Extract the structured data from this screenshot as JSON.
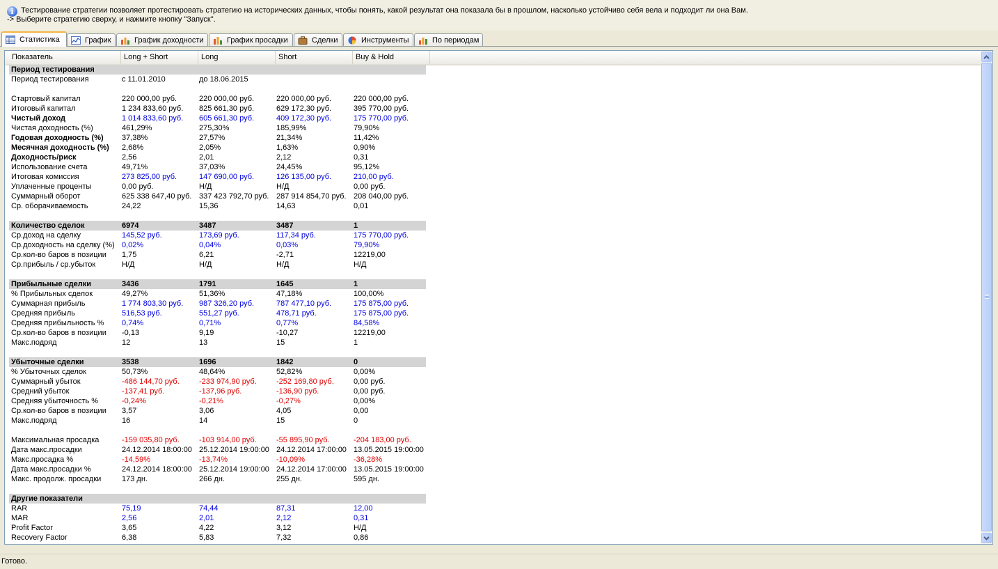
{
  "info": {
    "line1": "Тестирование стратегии позволяет протестировать стратегию на исторических данных, чтобы понять, какой результат она показала бы в прошлом, насколько устойчиво себя вела и подходит ли она Вам.",
    "line2": "-> Выберите стратегию сверху, и нажмите кнопку \"Запуск\"."
  },
  "tabs": [
    {
      "label": "Статистика",
      "icon": "table-icon"
    },
    {
      "label": "График",
      "icon": "chart-icon"
    },
    {
      "label": "График доходности",
      "icon": "bar-chart-icon"
    },
    {
      "label": "График просадки",
      "icon": "bar-chart-icon"
    },
    {
      "label": "Сделки",
      "icon": "briefcase-icon"
    },
    {
      "label": "Инструменты",
      "icon": "pie-chart-icon"
    },
    {
      "label": "По периодам",
      "icon": "bar-chart-icon"
    }
  ],
  "colors": {
    "positive": "#0000e0",
    "negative": "#e00000",
    "section_band": "#d4d4d4",
    "active_tab": "#f8b344"
  },
  "table": {
    "columns": [
      "Показатель",
      "Long + Short",
      "Long",
      "Short",
      "Buy & Hold"
    ],
    "rows": [
      {
        "kind": "section",
        "cells": [
          "Период тестирования",
          "",
          "",
          "",
          ""
        ]
      },
      {
        "kind": "row",
        "cells": [
          "Период тестирования",
          "с 11.01.2010",
          "до 18.06.2015",
          "",
          ""
        ]
      },
      {
        "kind": "blank"
      },
      {
        "kind": "row",
        "cells": [
          "Стартовый капитал",
          "220 000,00 руб.",
          "220 000,00 руб.",
          "220 000,00 руб.",
          "220 000,00 руб."
        ]
      },
      {
        "kind": "row",
        "cells": [
          "Итоговый капитал",
          "1 234 833,60 руб.",
          "825 661,30 руб.",
          "629 172,30 руб.",
          "395 770,00 руб."
        ]
      },
      {
        "kind": "row",
        "bold": true,
        "color": "blue",
        "cells": [
          "Чистый доход",
          "1 014 833,60 руб.",
          "605 661,30 руб.",
          "409 172,30 руб.",
          "175 770,00 руб."
        ]
      },
      {
        "kind": "row",
        "cells": [
          "Чистая доходность (%)",
          "461,29%",
          "275,30%",
          "185,99%",
          "79,90%"
        ]
      },
      {
        "kind": "row",
        "bold": true,
        "cells": [
          "Годовая доходность (%)",
          "37,38%",
          "27,57%",
          "21,34%",
          "11,42%"
        ]
      },
      {
        "kind": "row",
        "bold": true,
        "cells": [
          "Месячная доходность (%)",
          "2,68%",
          "2,05%",
          "1,63%",
          "0,90%"
        ]
      },
      {
        "kind": "row",
        "bold": true,
        "cells": [
          "Доходность/риск",
          "2,56",
          "2,01",
          "2,12",
          "0,31"
        ]
      },
      {
        "kind": "row",
        "cells": [
          "Использование счета",
          "49,71%",
          "37,03%",
          "24,45%",
          "95,12%"
        ]
      },
      {
        "kind": "row",
        "color": "blue",
        "cells": [
          "Итоговая комиссия",
          "273 825,00 руб.",
          "147 690,00 руб.",
          "126 135,00 руб.",
          "210,00 руб."
        ]
      },
      {
        "kind": "row",
        "cells": [
          "Уплаченные проценты",
          "0,00 руб.",
          "Н/Д",
          "Н/Д",
          "0,00 руб."
        ]
      },
      {
        "kind": "row",
        "cells": [
          "Суммарный оборот",
          "625 338 647,40 руб.",
          "337 423 792,70 руб.",
          "287 914 854,70 руб.",
          "208 040,00 руб."
        ]
      },
      {
        "kind": "row",
        "cells": [
          "Ср. оборачиваемость",
          "24,22",
          "15,36",
          "14,63",
          "0,01"
        ]
      },
      {
        "kind": "blank"
      },
      {
        "kind": "section",
        "cells": [
          "Количество сделок",
          "6974",
          "3487",
          "3487",
          "1"
        ]
      },
      {
        "kind": "row",
        "color": "blue",
        "cells": [
          "Ср.доход на сделку",
          "145,52 руб.",
          "173,69 руб.",
          "117,34 руб.",
          "175 770,00 руб."
        ]
      },
      {
        "kind": "row",
        "color": "blue",
        "cells": [
          "Ср.доходность на сделку (%)",
          "0,02%",
          "0,04%",
          "0,03%",
          "79,90%"
        ]
      },
      {
        "kind": "row",
        "cells": [
          "Ср.кол-во баров в позиции",
          "1,75",
          "6,21",
          "-2,71",
          "12219,00"
        ]
      },
      {
        "kind": "row",
        "cells": [
          "Ср.прибыль / ср.убыток",
          "Н/Д",
          "Н/Д",
          "Н/Д",
          "Н/Д"
        ]
      },
      {
        "kind": "blank"
      },
      {
        "kind": "section",
        "cells": [
          "Прибыльные сделки",
          "3436",
          "1791",
          "1645",
          "1"
        ]
      },
      {
        "kind": "row",
        "cells": [
          "% Прибыльных сделок",
          "49,27%",
          "51,36%",
          "47,18%",
          "100,00%"
        ]
      },
      {
        "kind": "row",
        "color": "blue",
        "cells": [
          "Суммарная прибыль",
          "1 774 803,30 руб.",
          "987 326,20 руб.",
          "787 477,10 руб.",
          "175 875,00 руб."
        ]
      },
      {
        "kind": "row",
        "color": "blue",
        "cells": [
          "Средняя прибыль",
          "516,53 руб.",
          "551,27 руб.",
          "478,71 руб.",
          "175 875,00 руб."
        ]
      },
      {
        "kind": "row",
        "color": "blue",
        "cells": [
          "Средняя прибыльность %",
          "0,74%",
          "0,71%",
          "0,77%",
          "84,58%"
        ]
      },
      {
        "kind": "row",
        "cells": [
          "Ср.кол-во баров в позиции",
          "-0,13",
          "9,19",
          "-10,27",
          "12219,00"
        ]
      },
      {
        "kind": "row",
        "cells": [
          "Макс.подряд",
          "12",
          "13",
          "15",
          "1"
        ]
      },
      {
        "kind": "blank"
      },
      {
        "kind": "section",
        "cells": [
          "Убыточные сделки",
          "3538",
          "1696",
          "1842",
          "0"
        ]
      },
      {
        "kind": "row",
        "cells": [
          "% Убыточных сделок",
          "50,73%",
          "48,64%",
          "52,82%",
          "0,00%"
        ]
      },
      {
        "kind": "row",
        "color": "red",
        "last_plain": true,
        "cells": [
          "Суммарный убыток",
          "-486 144,70 руб.",
          "-233 974,90 руб.",
          "-252 169,80 руб.",
          "0,00 руб."
        ]
      },
      {
        "kind": "row",
        "color": "red",
        "last_plain": true,
        "cells": [
          "Средний убыток",
          "-137,41 руб.",
          "-137,96 руб.",
          "-136,90 руб.",
          "0,00 руб."
        ]
      },
      {
        "kind": "row",
        "color": "red",
        "last_plain": true,
        "cells": [
          "Средняя убыточность %",
          "-0,24%",
          "-0,21%",
          "-0,27%",
          "0,00%"
        ]
      },
      {
        "kind": "row",
        "cells": [
          "Ср.кол-во баров в позиции",
          "3,57",
          "3,06",
          "4,05",
          "0,00"
        ]
      },
      {
        "kind": "row",
        "cells": [
          "Макс.подряд",
          "16",
          "14",
          "15",
          "0"
        ]
      },
      {
        "kind": "blank"
      },
      {
        "kind": "row",
        "color": "red",
        "cells": [
          "Максимальная просадка",
          "-159 035,80 руб.",
          "-103 914,00 руб.",
          "-55 895,90 руб.",
          "-204 183,00 руб."
        ]
      },
      {
        "kind": "row",
        "cells": [
          "Дата макс.просадки",
          "24.12.2014 18:00:00",
          "25.12.2014 19:00:00",
          "24.12.2014 17:00:00",
          "13.05.2015 19:00:00"
        ]
      },
      {
        "kind": "row",
        "color": "red",
        "cells": [
          "Макс.просадка %",
          "-14,59%",
          "-13,74%",
          "-10,09%",
          "-36,28%"
        ]
      },
      {
        "kind": "row",
        "cells": [
          "Дата макс.просадки %",
          "24.12.2014 18:00:00",
          "25.12.2014 19:00:00",
          "24.12.2014 17:00:00",
          "13.05.2015 19:00:00"
        ]
      },
      {
        "kind": "row",
        "cells": [
          "Макс. продолж. просадки",
          "173 дн.",
          "266 дн.",
          "255 дн.",
          "595 дн."
        ]
      },
      {
        "kind": "blank"
      },
      {
        "kind": "section",
        "cells": [
          "Другие показатели",
          "",
          "",
          "",
          ""
        ]
      },
      {
        "kind": "row",
        "color": "blue",
        "cells": [
          "RAR",
          "75,19",
          "74,44",
          "87,31",
          "12,00"
        ]
      },
      {
        "kind": "row",
        "color": "blue",
        "cells": [
          "MAR",
          "2,56",
          "2,01",
          "2,12",
          "0,31"
        ]
      },
      {
        "kind": "row",
        "last_plain": true,
        "cells": [
          "Profit Factor",
          "3,65",
          "4,22",
          "3,12",
          "Н/Д"
        ]
      },
      {
        "kind": "row",
        "cells": [
          "Recovery Factor",
          "6,38",
          "5,83",
          "7,32",
          "0,86"
        ]
      }
    ]
  },
  "status": {
    "text": "Готово."
  }
}
